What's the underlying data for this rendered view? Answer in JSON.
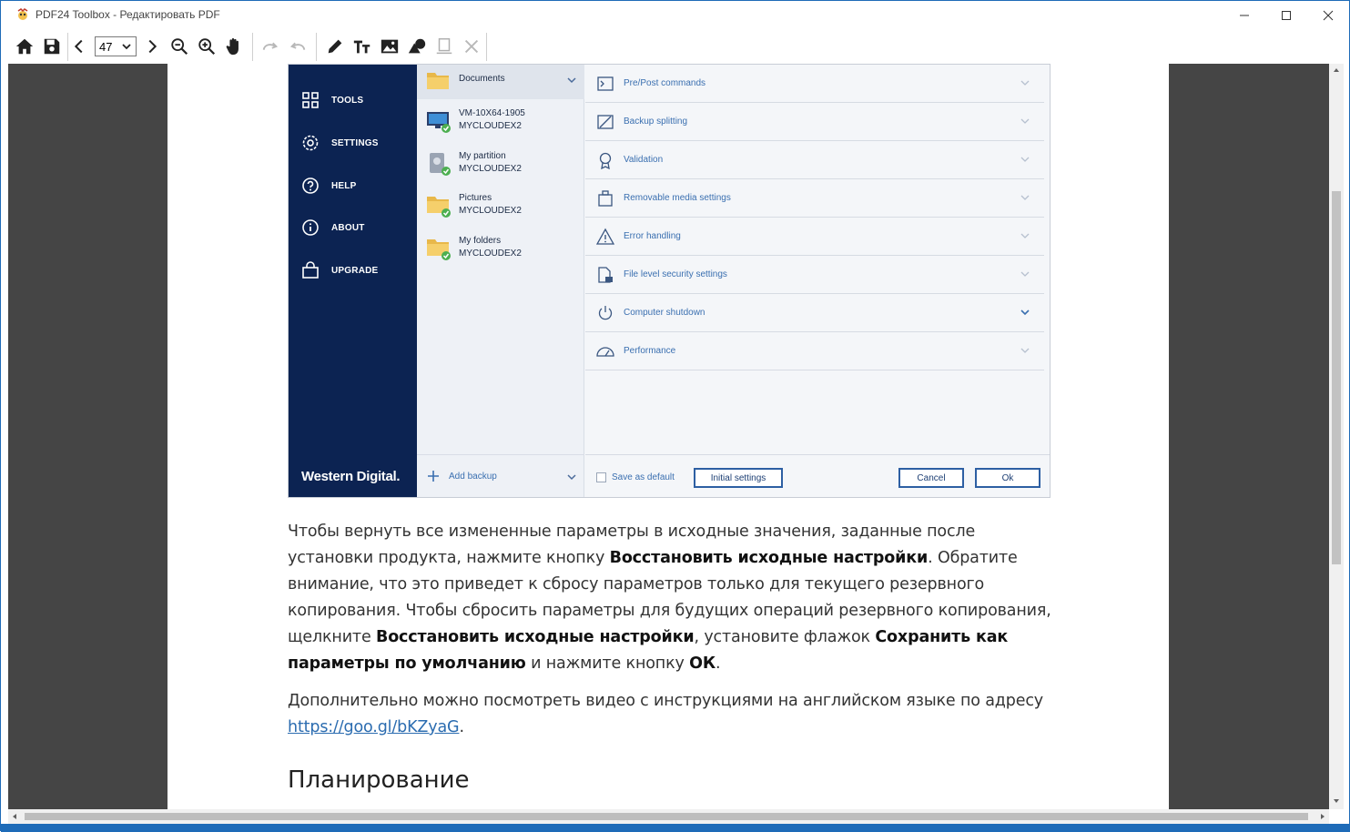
{
  "window": {
    "title": "PDF24 Toolbox - Редактировать PDF"
  },
  "toolbar": {
    "page_number": "47"
  },
  "screenshot": {
    "sidebar": {
      "items": [
        {
          "label": "TOOLS"
        },
        {
          "label": "SETTINGS"
        },
        {
          "label": "HELP"
        },
        {
          "label": "ABOUT"
        },
        {
          "label": "UPGRADE"
        }
      ],
      "brand": "Western Digital."
    },
    "backup_list": {
      "header": "Documents",
      "items": [
        {
          "name": "VM-10X64-1905",
          "sub": "MYCLOUDEX2"
        },
        {
          "name": "My partition",
          "sub": "MYCLOUDEX2"
        },
        {
          "name": "Pictures",
          "sub": "MYCLOUDEX2"
        },
        {
          "name": "My folders",
          "sub": "MYCLOUDEX2"
        }
      ],
      "add_backup": "Add backup"
    },
    "options": [
      {
        "label": "Pre/Post commands"
      },
      {
        "label": "Backup splitting"
      },
      {
        "label": "Validation"
      },
      {
        "label": "Removable media settings"
      },
      {
        "label": "Error handling"
      },
      {
        "label": "File level security settings"
      },
      {
        "label": "Computer shutdown"
      },
      {
        "label": "Performance"
      }
    ],
    "footer": {
      "save_default": "Save as default",
      "initial_settings": "Initial settings",
      "cancel": "Cancel",
      "ok": "Ok"
    }
  },
  "article": {
    "p1": [
      "Чтобы вернуть все измененные параметры в исходные значения, заданные после установки продукта, нажмите кнопку ",
      "Восстановить исходные настройки",
      ". Обратите внимание, что это приведет к сбросу параметров только для текущего резервного копирования. Чтобы сбросить параметры для будущих операций резервного копирования, щелкните ",
      "Восстановить исходные настройки",
      ", установите флажок ",
      "Сохранить как параметры по умолчанию",
      " и нажмите кнопку ",
      "ОК",
      "."
    ],
    "p2_text": "Дополнительно можно посмотреть видео с инструкциями на английском языке по адресу ",
    "p2_link": "https://goo.gl/bKZyaG",
    "p2_end": ".",
    "heading": "Планирование"
  }
}
